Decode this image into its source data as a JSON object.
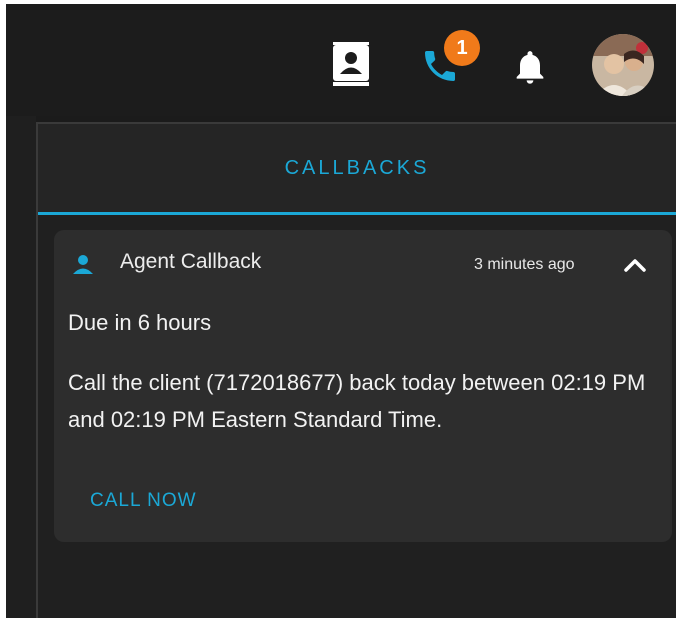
{
  "topbar": {
    "notification_count": "1",
    "icons": [
      "contacts-book-icon",
      "phone-icon",
      "bell-icon",
      "user-avatar"
    ]
  },
  "panel": {
    "title": "CALLBACKS"
  },
  "callback": {
    "title": "Agent Callback",
    "time_ago": "3 minutes ago",
    "due": "Due in 6 hours",
    "message": "Call the client (7172018677) back today between 02:19 PM and 02:19 PM Eastern Standard Time.",
    "action_label": "CALL NOW"
  },
  "colors": {
    "accent": "#1ba8d6",
    "badge": "#f07a1a",
    "background": "#1b1b1b",
    "card": "#2d2d2d"
  }
}
